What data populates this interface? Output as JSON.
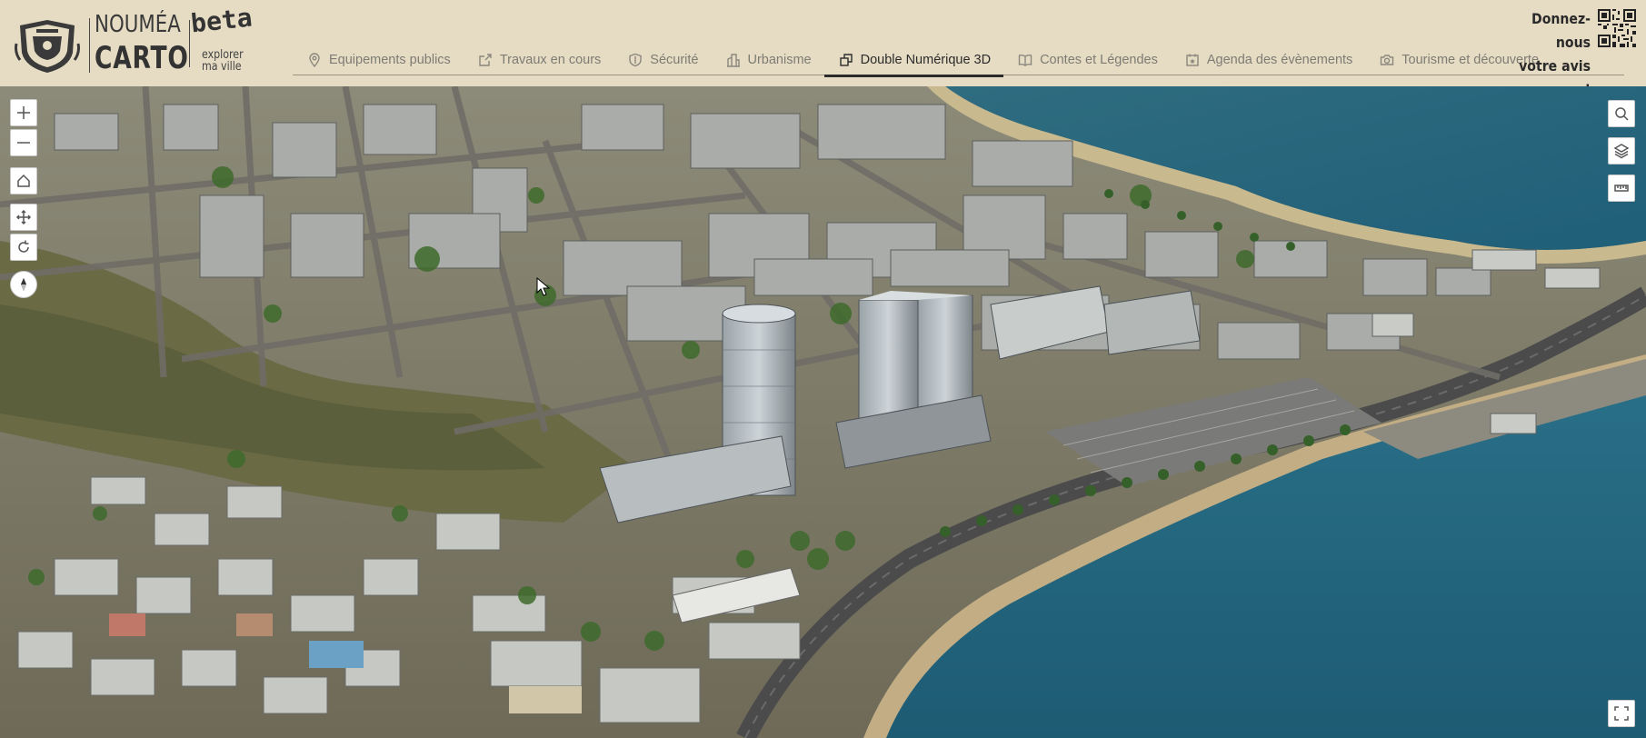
{
  "brand": {
    "line1": "NOUMÉA",
    "line2": "CARTO",
    "beta": "beta",
    "tagline_line1": "explorer",
    "tagline_line2": "ma ville"
  },
  "nav": {
    "items": [
      {
        "label": "Equipements publics",
        "icon": "location-pin-icon",
        "active": false
      },
      {
        "label": "Travaux en cours",
        "icon": "share-box-icon",
        "active": false
      },
      {
        "label": "Sécurité",
        "icon": "shield-icon",
        "active": false
      },
      {
        "label": "Urbanisme",
        "icon": "buildings-icon",
        "active": false
      },
      {
        "label": "Double Numérique 3D",
        "icon": "cube-layers-icon",
        "active": true
      },
      {
        "label": "Contes et Légendes",
        "icon": "open-book-icon",
        "active": false
      },
      {
        "label": "Agenda des évènements",
        "icon": "calendar-star-icon",
        "active": false
      },
      {
        "label": "Tourisme et découverte",
        "icon": "camera-icon",
        "active": false
      }
    ]
  },
  "feedback": {
    "line1": "Donnez-nous",
    "line2": "votre avis !"
  },
  "map_controls": {
    "left": [
      "zoom-in-icon",
      "zoom-out-icon",
      "home-icon",
      "pan-icon",
      "rotate-icon",
      "compass-icon"
    ],
    "right": [
      "search-icon",
      "layers-icon",
      "measure-icon"
    ],
    "bottom_right": "fullscreen-icon"
  },
  "colors": {
    "header_bg": "#e6dcc3",
    "active_text": "#2b2b2b",
    "inactive_text": "#7d7b74",
    "sea": "#2b6f86"
  }
}
